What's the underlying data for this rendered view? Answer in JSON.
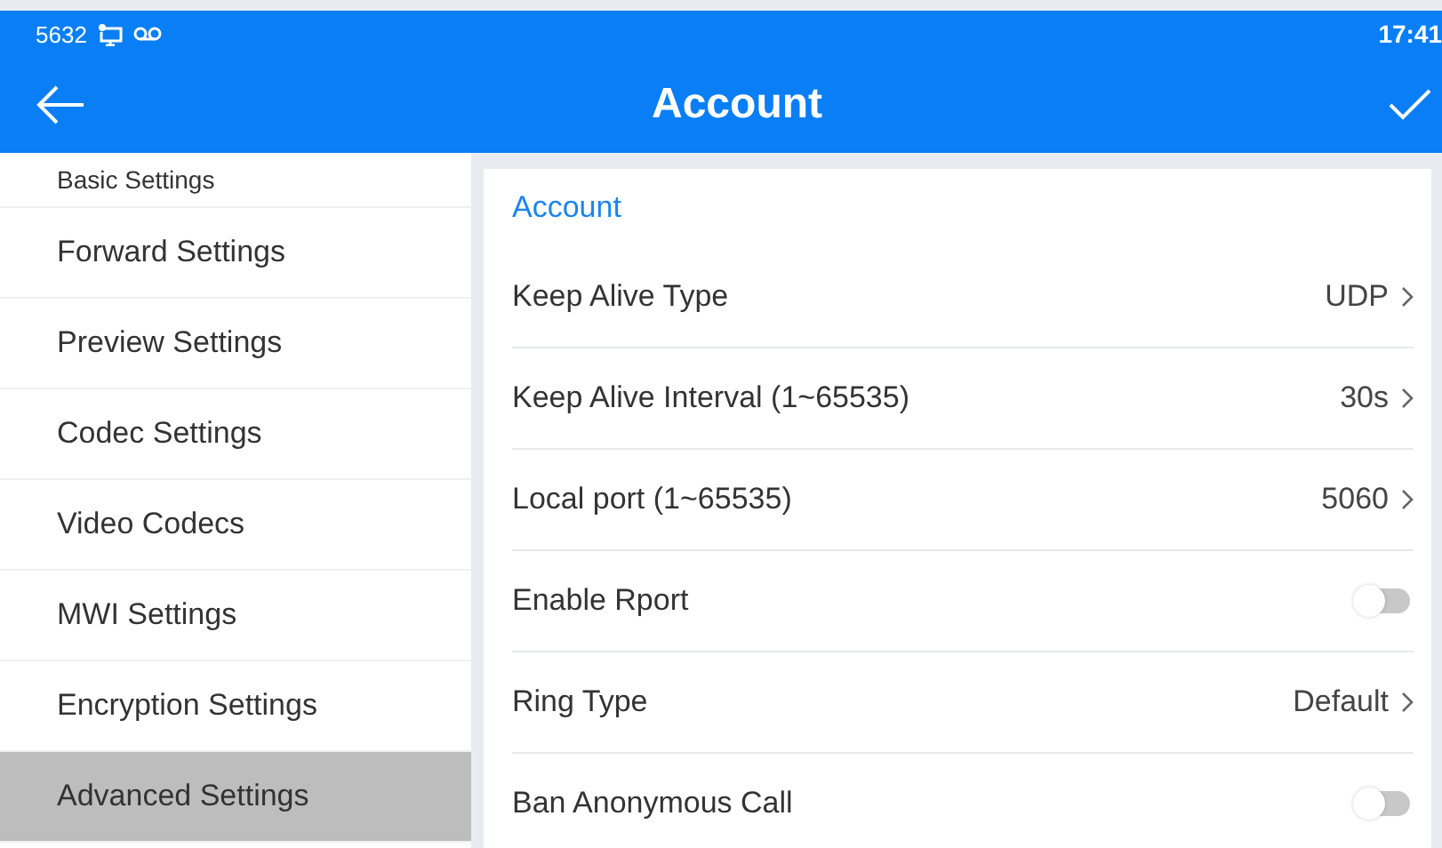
{
  "status_bar": {
    "extension": "5632",
    "time": "17:41"
  },
  "header": {
    "title": "Account"
  },
  "sidebar": {
    "items": [
      {
        "label": "Basic Settings",
        "selected": false
      },
      {
        "label": "Forward Settings",
        "selected": false
      },
      {
        "label": "Preview Settings",
        "selected": false
      },
      {
        "label": "Codec Settings",
        "selected": false
      },
      {
        "label": "Video Codecs",
        "selected": false
      },
      {
        "label": "MWI Settings",
        "selected": false
      },
      {
        "label": "Encryption Settings",
        "selected": false
      },
      {
        "label": "Advanced Settings",
        "selected": true
      }
    ]
  },
  "panel": {
    "section_title": "Account",
    "rows": [
      {
        "kind": "value",
        "label": "Keep Alive Type",
        "value": "UDP"
      },
      {
        "kind": "value",
        "label": "Keep Alive Interval (1~65535)",
        "value": "30s"
      },
      {
        "kind": "value",
        "label": "Local port (1~65535)",
        "value": "5060"
      },
      {
        "kind": "toggle",
        "label": "Enable Rport",
        "on": false
      },
      {
        "kind": "value",
        "label": "Ring Type",
        "value": "Default"
      },
      {
        "kind": "toggle",
        "label": "Ban Anonymous Call",
        "on": false
      }
    ]
  }
}
